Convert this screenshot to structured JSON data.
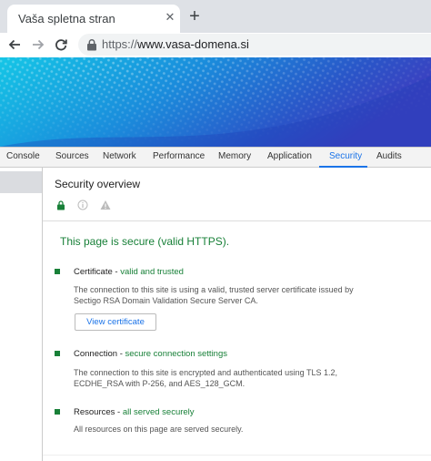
{
  "browser": {
    "tab_title": "Vaša spletna stran",
    "tab_close": "✕",
    "new_tab": "+",
    "url_scheme": "https://",
    "url_host": "www.vasa-domena.si"
  },
  "devtools": {
    "tabs": [
      "Console",
      "Sources",
      "Network",
      "Performance",
      "Memory",
      "Application",
      "Security",
      "Audits"
    ],
    "active_tab": "Security"
  },
  "security": {
    "overview_title": "Security overview",
    "page_status": "This page is secure (valid HTTPS).",
    "items": [
      {
        "label": "Certificate",
        "sep": " - ",
        "status": "valid and trusted",
        "description": "The connection to this site is using a valid, trusted server certificate issued by Sectigo RSA Domain Validation Secure Server CA."
      },
      {
        "label": "Connection",
        "sep": " - ",
        "status": "secure connection settings",
        "description": "The connection to this site is encrypted and authenticated using TLS 1.2, ECDHE_RSA with P-256, and AES_128_GCM."
      },
      {
        "label": "Resources",
        "sep": " - ",
        "status": "all served securely",
        "description": "All resources on this page are served securely."
      }
    ],
    "view_certificate_label": "View certificate"
  },
  "colors": {
    "secure_green": "#188038",
    "accent_blue": "#1a73e8"
  }
}
